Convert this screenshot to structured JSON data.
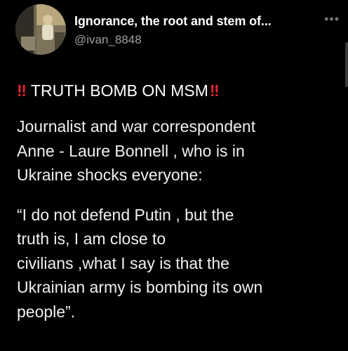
{
  "header": {
    "display_name": "Ignorance, the root and stem of...",
    "handle": "@ivan_8848",
    "more_icon": "more-dots-icon"
  },
  "headline": {
    "prefix_emoji": "‼",
    "text": "TRUTH BOMB ON MSM",
    "suffix_emoji": "‼"
  },
  "body": {
    "para1_lines": [
      "Journalist and war correspondent",
      "Anne - Laure Bonnell ,  who is in",
      "Ukraine shocks everyone:"
    ],
    "para2_lines": [
      "“I do not defend Putin , but the",
      "truth is, I am close to",
      "civilians ,what I say is that the",
      "Ukrainian army is bombing its own",
      "people”."
    ]
  },
  "colors": {
    "background": "#000000",
    "text": "#e7e9ea",
    "muted": "#9aa0a6",
    "accent_red": "#e0242c"
  }
}
